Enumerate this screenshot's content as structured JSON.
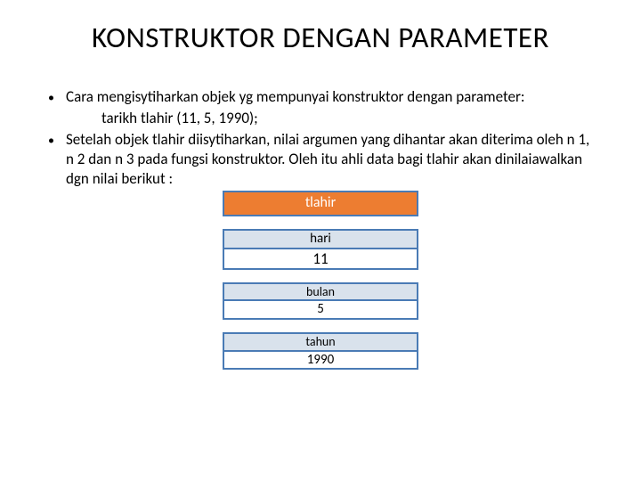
{
  "title": "KONSTRUKTOR DENGAN PARAMETER",
  "bullet1": "Cara mengisytiharkan objek yg mempunyai konstruktor dengan parameter:",
  "indent1": "tarikh tlahir (11, 5, 1990);",
  "bullet2": "Setelah objek tlahir diisytiharkan, nilai argumen yang dihantar akan diterima oleh n 1, n 2 dan n 3 pada fungsi konstruktor. Oleh itu ahli data bagi tlahir akan dinilaiawalkan dgn nilai berikut :",
  "obj_name": "tlahir",
  "fields": {
    "hari": {
      "label": "hari",
      "value": "11"
    },
    "bulan": {
      "label": "bulan",
      "value": "5"
    },
    "tahun": {
      "label": "tahun",
      "value": "1990"
    }
  }
}
